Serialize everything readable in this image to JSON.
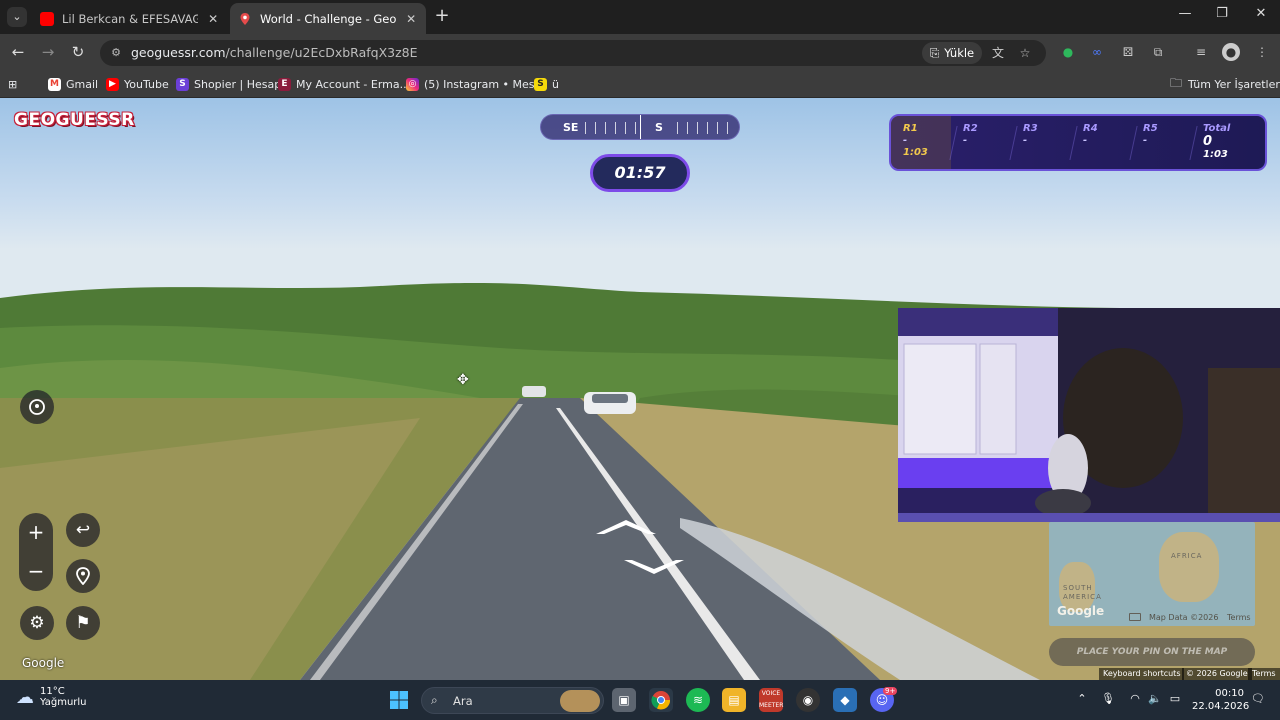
{
  "tabs": [
    {
      "title": "Lil Berkcan & EFESAVAGE - Para",
      "favicon": "youtube-icon",
      "color": "#ff0000",
      "active": false
    },
    {
      "title": "World - Challenge - GeoGuessr",
      "favicon": "geoguessr-pin-icon",
      "color": "#e54b4b",
      "active": true
    }
  ],
  "omnibox": {
    "host": "geoguessr.com",
    "path": "/challenge/u2EcDxbRafqX3z8E",
    "install_label": "Yükle"
  },
  "bookmarks": [
    {
      "label": "Gmail",
      "icon": "gmail-icon",
      "color": "#ea4335",
      "glyph": "M"
    },
    {
      "label": "YouTube",
      "icon": "youtube-icon",
      "color": "#ff0000",
      "glyph": "▶"
    },
    {
      "label": "Shopier | Hesap",
      "icon": "shopier-icon",
      "color": "#6b3fd6",
      "glyph": "S"
    },
    {
      "label": "My Account - Erma...",
      "icon": "ermaks-icon",
      "color": "#8a1c3c",
      "glyph": "E"
    },
    {
      "label": "(5) Instagram • Mes...",
      "icon": "instagram-icon",
      "color": "#d6249f",
      "glyph": "◎"
    },
    {
      "label": "ü",
      "icon": "snapchat-like-icon",
      "color": "#f5d90a",
      "glyph": "S"
    }
  ],
  "all_bookmarks_label": "Tüm Yer İşaretleri",
  "game": {
    "logo": "GEOGUESSR",
    "compass": {
      "left_dir": "SE",
      "center_dir": "S"
    },
    "timer": "01:57",
    "rounds": [
      {
        "label": "R1",
        "value": "-",
        "time": "1:03",
        "current": true
      },
      {
        "label": "R2",
        "value": "-"
      },
      {
        "label": "R3",
        "value": "-"
      },
      {
        "label": "R4",
        "value": "-"
      },
      {
        "label": "R5",
        "value": "-"
      }
    ],
    "total": {
      "label": "Total",
      "score": "0",
      "time": "1:03"
    },
    "google_watermark": "Google",
    "minimap": {
      "label_africa": "AFRICA",
      "label_south_america": "SOUTH\nAMERICA",
      "google": "Google",
      "map_data": "Map Data ©2026",
      "terms": "Terms"
    },
    "place_pin_label": "PLACE YOUR PIN ON THE MAP",
    "attribution": {
      "keyboard": "Keyboard shortcuts",
      "copyright": "© 2026 Google",
      "terms": "Terms"
    }
  },
  "taskbar": {
    "weather_temp": "11°C",
    "weather_desc": "Yağmurlu",
    "search_placeholder": "Ara",
    "time": "00:10",
    "date": "22.04.2026",
    "discord_badge": "9+"
  }
}
